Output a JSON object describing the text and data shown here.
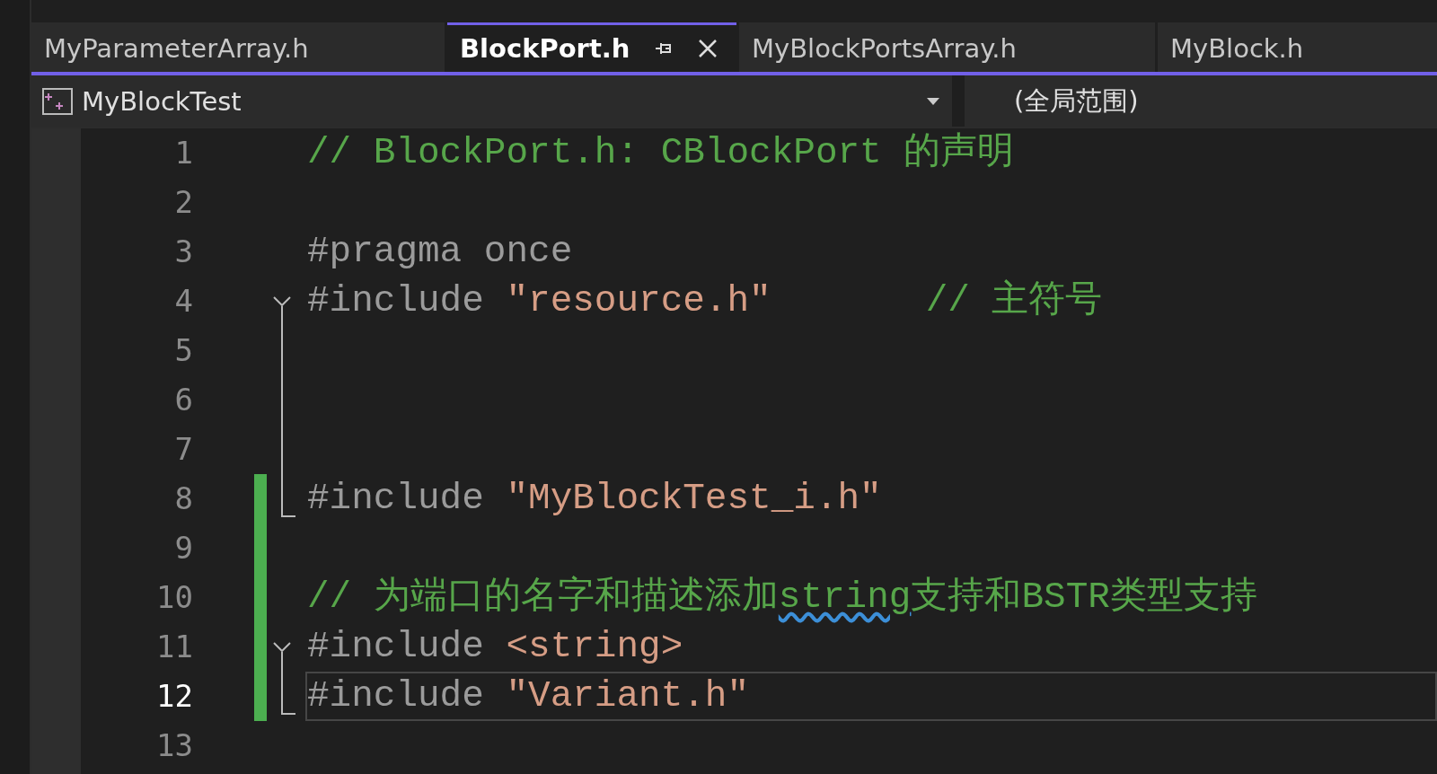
{
  "tabs": [
    {
      "label": "MyParameterArray.h",
      "selected": false
    },
    {
      "label": "BlockPort.h",
      "selected": true
    },
    {
      "label": "MyBlockPortsArray.h",
      "selected": false
    },
    {
      "label": "MyBlock.h",
      "selected": false
    }
  ],
  "nav_bar": {
    "project": "MyBlockTest",
    "scope": "(全局范围)"
  },
  "lines": [
    {
      "number": "1",
      "changed": false,
      "current": false,
      "tokens": [
        {
          "kind": "comment",
          "text": "// BlockPort.h: CBlockPort 的声明",
          "squiggle": false
        }
      ]
    },
    {
      "number": "2",
      "changed": false,
      "current": false
    },
    {
      "number": "3",
      "changed": false,
      "current": false,
      "tokens": [
        {
          "kind": "preproc",
          "text": "#pragma once",
          "squiggle": false
        }
      ]
    },
    {
      "number": "4",
      "changed": false,
      "current": false,
      "expanded": true,
      "tokens": [
        {
          "kind": "preproc",
          "text": "#include ",
          "squiggle": false
        },
        {
          "kind": "string",
          "text": "\"resource.h\"",
          "squiggle": false
        },
        {
          "kind": "trailing",
          "text": "// 主符号",
          "squiggle": false
        }
      ],
      "children": [
        {
          "number": "5",
          "changed": false,
          "current": false
        },
        {
          "number": "6",
          "changed": false,
          "current": false
        },
        {
          "number": "7",
          "changed": false,
          "current": false
        },
        {
          "number": "8",
          "changed": true,
          "current": false,
          "tokens": [
            {
              "kind": "preproc",
              "text": "#include ",
              "squiggle": false
            },
            {
              "kind": "string",
              "text": "\"MyBlockTest_i.h\"",
              "squiggle": false
            }
          ]
        }
      ]
    },
    {
      "number": "9",
      "changed": true,
      "current": false
    },
    {
      "number": "10",
      "changed": true,
      "current": false,
      "tokens": [
        {
          "kind": "comment",
          "text": "// 为端口的名字和描述添加",
          "squiggle": false
        },
        {
          "kind": "comment",
          "text": "string",
          "squiggle": true
        },
        {
          "kind": "comment",
          "text": "支持和BSTR类型支持",
          "squiggle": false
        }
      ]
    },
    {
      "number": "11",
      "changed": true,
      "current": false,
      "expanded": true,
      "tokens": [
        {
          "kind": "preproc",
          "text": "#include ",
          "squiggle": false
        },
        {
          "kind": "string",
          "text": "<string>",
          "squiggle": false
        }
      ],
      "children": [
        {
          "number": "12",
          "changed": true,
          "current": true,
          "tokens": [
            {
              "kind": "preproc",
              "text": "#include ",
              "squiggle": false
            },
            {
              "kind": "string",
              "text": "\"Variant.h\"",
              "squiggle": false
            }
          ]
        }
      ]
    },
    {
      "number": "13",
      "changed": false,
      "current": false
    }
  ]
}
